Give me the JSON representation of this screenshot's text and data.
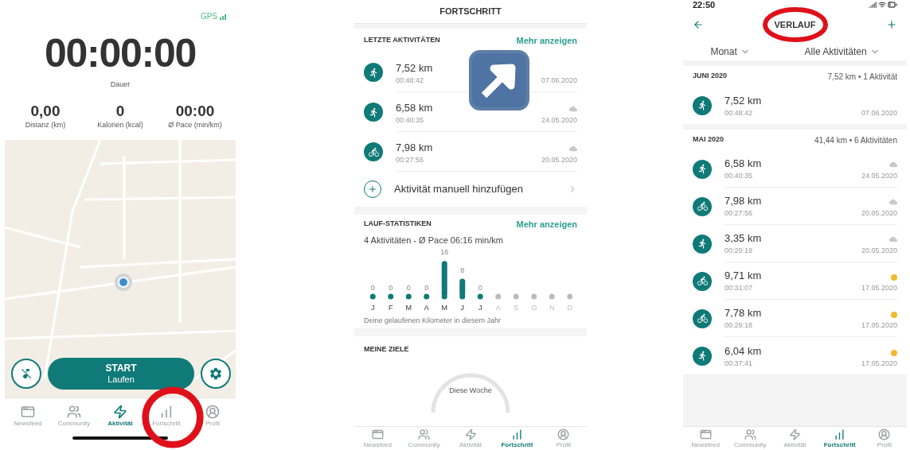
{
  "tracking_screen": {
    "gps_label": "GPS",
    "timer": "00:00:00",
    "timer_label": "Dauer",
    "stats": [
      {
        "value": "0,00",
        "label": "Distanz (km)"
      },
      {
        "value": "0",
        "label": "Kalorien (kcal)"
      },
      {
        "value": "00:00",
        "label": "Ø Pace (min/km)"
      }
    ],
    "start_button": {
      "title": "START",
      "subtitle": "Laufen"
    },
    "tab_bar": [
      {
        "kind": "newsfeed",
        "label": "Newsfeed",
        "selected": false
      },
      {
        "kind": "community",
        "label": "Community",
        "selected": false
      },
      {
        "kind": "activity",
        "label": "Aktivität",
        "selected": true
      },
      {
        "kind": "progress",
        "label": "Fortschritt",
        "selected": false
      },
      {
        "kind": "profile",
        "label": "Profil",
        "selected": false
      }
    ]
  },
  "progress_screen": {
    "title": "FORTSCHRITT",
    "recent": {
      "heading": "LETZTE AKTIVITÄTEN",
      "more_link": "Mehr anzeigen",
      "activities": [
        {
          "kind": "run",
          "distance": "7,52 km",
          "duration": "00:48:42",
          "date": "07.06.2020"
        },
        {
          "kind": "run",
          "distance": "6,58 km",
          "duration": "00:40:35",
          "weather": {
            "kind": "cloud"
          },
          "date": "24.05.2020"
        },
        {
          "kind": "bike",
          "distance": "7,98 km",
          "duration": "00:27:56",
          "weather": {
            "kind": "cloud"
          },
          "date": "20.05.2020"
        }
      ],
      "add_label": "Aktivität manuell hinzufügen"
    },
    "run_stats": {
      "heading": "LAUF-STATISTIKEN",
      "more_link": "Mehr anzeigen",
      "summary": "4 Aktivitäten - Ø Pace 06:16 min/km",
      "chart_data": {
        "type": "bar",
        "categories": [
          "J",
          "F",
          "M",
          "A",
          "M",
          "J",
          "J",
          "A",
          "S",
          "O",
          "N",
          "D"
        ],
        "values": [
          0,
          0,
          0,
          0,
          16,
          8,
          0,
          null,
          null,
          null,
          null,
          null
        ],
        "data_labels": true
      },
      "caption": "Deine gelaufenen Kilometer in diesem Jahr"
    },
    "goals": {
      "heading": "MEINE ZIELE",
      "gauge_label": "Diese Woche"
    },
    "tab_bar": [
      {
        "kind": "newsfeed",
        "label": "Newsfeed",
        "selected": false
      },
      {
        "kind": "community",
        "label": "Community",
        "selected": false
      },
      {
        "kind": "activity",
        "label": "Aktivität",
        "selected": false
      },
      {
        "kind": "progress",
        "label": "Fortschritt",
        "selected": true
      },
      {
        "kind": "profile",
        "label": "Profil",
        "selected": false
      }
    ]
  },
  "history_screen": {
    "status_time": "22:50",
    "title": "VERLAUF",
    "filters": [
      "Monat",
      "Alle Aktivitäten"
    ],
    "months": [
      {
        "name": "JUNI 2020",
        "summary": "7,52 km • 1 Aktivität",
        "activities": [
          {
            "kind": "run",
            "distance": "7,52 km",
            "duration": "00:48:42",
            "date": "07.06.2020"
          }
        ]
      },
      {
        "name": "MAI 2020",
        "summary": "41,44 km • 6 Aktivitäten",
        "activities": [
          {
            "kind": "run",
            "distance": "6,58 km",
            "duration": "00:40:35",
            "weather": {
              "kind": "cloud"
            },
            "date": "24.05.2020"
          },
          {
            "kind": "bike",
            "distance": "7,98 km",
            "duration": "00:27:56",
            "weather": {
              "kind": "cloud"
            },
            "date": "20.05.2020"
          },
          {
            "kind": "run",
            "distance": "3,35 km",
            "duration": "00:20:19",
            "weather": {
              "kind": "cloud"
            },
            "date": "20.05.2020"
          },
          {
            "kind": "bike",
            "distance": "9,71 km",
            "duration": "00:31:07",
            "weather": {
              "kind": "sun"
            },
            "date": "17.05.2020"
          },
          {
            "kind": "bike",
            "distance": "7,78 km",
            "duration": "00:29:18",
            "weather": {
              "kind": "sun"
            },
            "date": "17.05.2020"
          },
          {
            "kind": "run",
            "distance": "6,04 km",
            "duration": "00:37:41",
            "weather": {
              "kind": "sun"
            },
            "date": "17.05.2020"
          }
        ]
      }
    ],
    "tab_bar": [
      {
        "kind": "newsfeed",
        "label": "Newsfeed",
        "selected": false
      },
      {
        "kind": "community",
        "label": "Community",
        "selected": false
      },
      {
        "kind": "activity",
        "label": "Aktivität",
        "selected": false
      },
      {
        "kind": "progress",
        "label": "Fortschritt",
        "selected": true
      },
      {
        "kind": "profile",
        "label": "Profil",
        "selected": false
      }
    ]
  }
}
